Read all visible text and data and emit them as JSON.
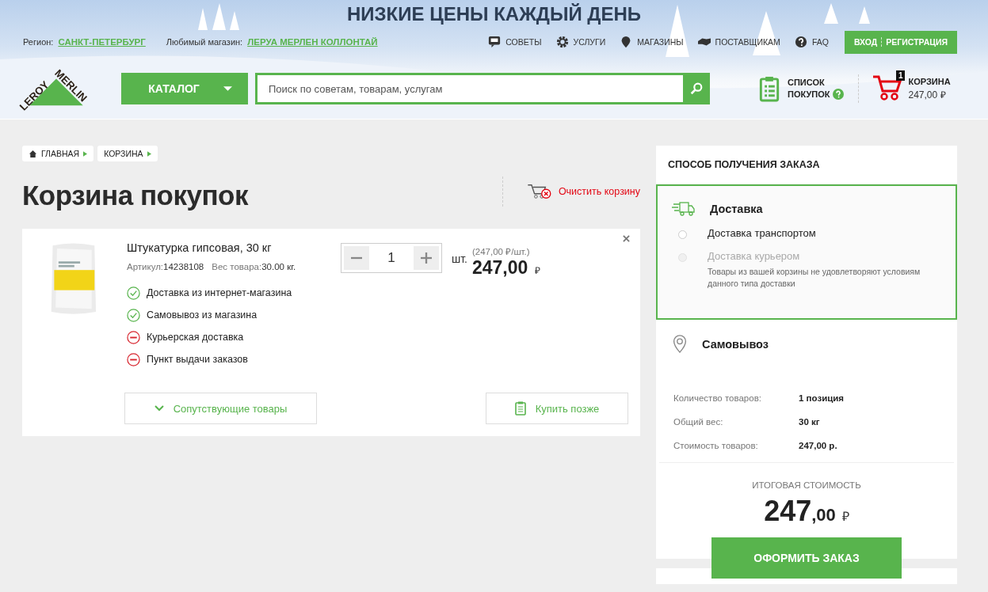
{
  "banner": {
    "title": "НИЗКИЕ ЦЕНЫ КАЖДЫЙ ДЕНЬ"
  },
  "top_bar": {
    "region_label": "Регион:",
    "region": "САНКТ-ПЕТЕРБУРГ",
    "store_label": "Любимый магазин:",
    "store": "ЛЕРУА МЕРЛЕН КОЛЛОНТАЙ",
    "links": [
      {
        "kind": "advice",
        "label": "СОВЕТЫ"
      },
      {
        "kind": "services",
        "label": "УСЛУГИ"
      },
      {
        "kind": "stores",
        "label": "МАГАЗИНЫ"
      },
      {
        "kind": "suppliers",
        "label": "ПОСТАВЩИКАМ"
      },
      {
        "kind": "faq",
        "label": "FAQ"
      }
    ],
    "login": "ВХОД",
    "register": "РЕГИСТРАЦИЯ"
  },
  "header": {
    "logo": [
      "LEROY",
      "MERLIN"
    ],
    "catalog": "КАТАЛОГ",
    "search_placeholder": "Поиск по советам, товарам, услугам",
    "shopping_list": [
      "СПИСОК",
      "ПОКУПОК"
    ],
    "cart": {
      "label": "КОРЗИНА",
      "count": "1",
      "total": "247,00",
      "currency": "₽"
    }
  },
  "breadcrumbs": [
    "ГЛАВНАЯ",
    "КОРЗИНА"
  ],
  "page_title": "Корзина покупок",
  "clear_cart": "Очистить корзину",
  "item": {
    "name": "Штукатурка гипсовая, 30 кг",
    "article_label": "Артикул:",
    "article": "14238108",
    "weight_label": "Вес товара:",
    "weight": "30.00 кг.",
    "quantity": "1",
    "unit": "шт.",
    "unit_price": "(247,00 ₽/шт.)",
    "price": "247,00",
    "currency": "₽",
    "options": [
      {
        "label": "Доставка из интернет-магазина",
        "available": true
      },
      {
        "label": "Самовывоз из магазина",
        "available": true
      },
      {
        "label": "Курьерская доставка",
        "available": false
      },
      {
        "label": "Пункт выдачи заказов",
        "available": false
      }
    ],
    "related": "Сопутствующие товары",
    "later": "Купить позже"
  },
  "order": {
    "title": "СПОСОБ ПОЛУЧЕНИЯ ЗАКАЗА",
    "methods": [
      {
        "kind": "delivery",
        "label": "Доставка",
        "selected": true,
        "options": [
          {
            "label": "Доставка транспортом",
            "selected": false,
            "disabled": false
          },
          {
            "label": "Доставка курьером",
            "selected": false,
            "disabled": true,
            "note": "Товары из вашей корзины не удовлетворяют условиям данного типа доставки"
          }
        ]
      },
      {
        "kind": "pickup",
        "label": "Самовывоз",
        "selected": false
      }
    ],
    "summary": [
      {
        "label": "Количество товаров:",
        "value": "1 позиция"
      },
      {
        "label": "Общий вес:",
        "value": "30 кг"
      },
      {
        "label": "Стоимость товаров:",
        "value": "247,00 р."
      }
    ],
    "total_label": "ИТОГОВАЯ СТОИМОСТЬ",
    "total_int": "247",
    "total_dec": ",00",
    "currency": "₽",
    "checkout": "ОФОРМИТЬ ЗАКАЗ"
  }
}
